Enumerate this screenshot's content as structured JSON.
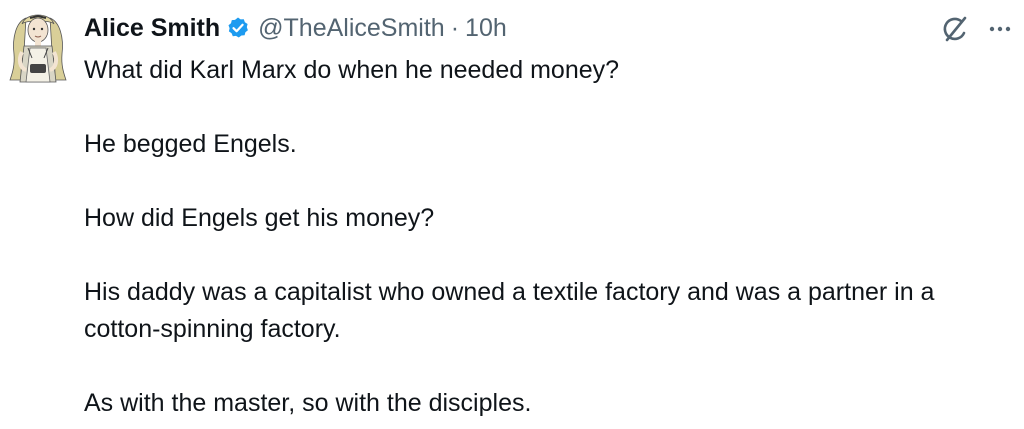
{
  "tweet": {
    "display_name": "Alice Smith",
    "handle": "@TheAliceSmith",
    "separator": "·",
    "time": "10h",
    "verified_color": "#1d9bf0",
    "icons": {
      "verified": "verified-badge-icon",
      "grok": "grok-icon",
      "more": "more-options-icon"
    },
    "paragraphs": [
      "What did Karl Marx do when he needed money?",
      "He begged Engels.",
      "How did Engels get his money?",
      "His daddy was a capitalist who owned a textile factory and was a partner in a cotton-spinning factory.",
      "As with the master, so with the disciples."
    ]
  }
}
